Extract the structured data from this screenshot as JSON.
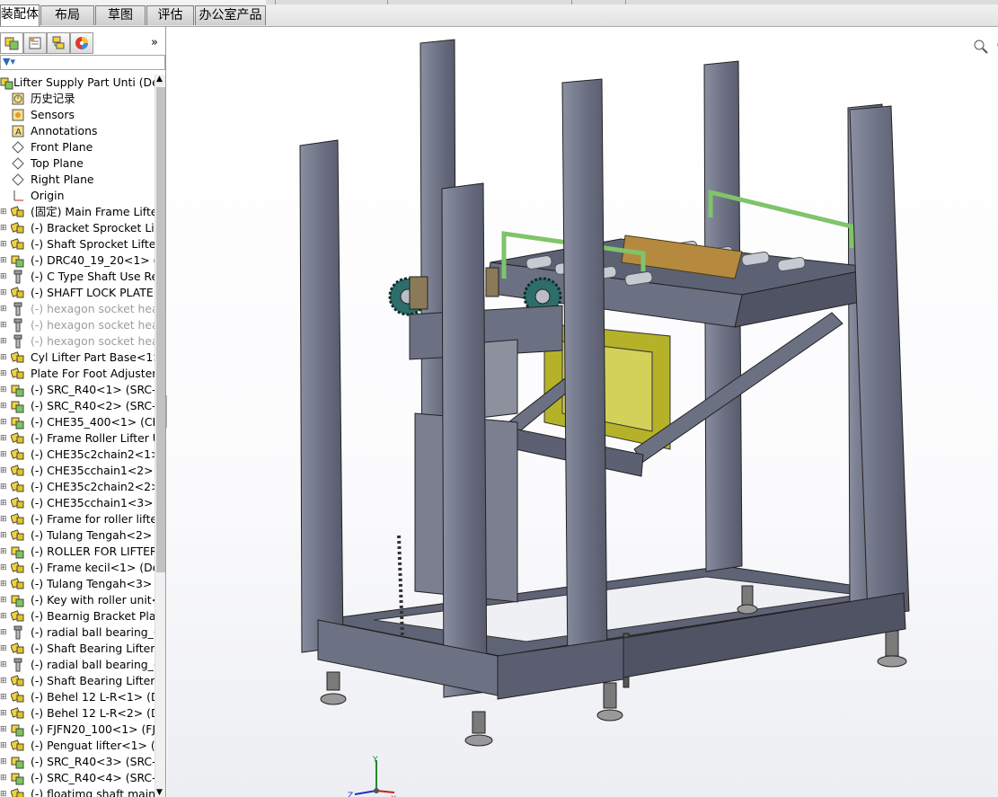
{
  "command_tabs": [
    "装配体",
    "布局",
    "草图",
    "评估",
    "办公室产品"
  ],
  "active_tab": "装配体",
  "tree": {
    "root": "Lifter Supply Part Unti  (De",
    "items": [
      {
        "label": "历史记录",
        "icon": "history-icon",
        "dim": false
      },
      {
        "label": "Sensors",
        "icon": "sensor-icon",
        "dim": false
      },
      {
        "label": "Annotations",
        "icon": "annotation-icon",
        "dim": false
      },
      {
        "label": "Front Plane",
        "icon": "plane-icon",
        "dim": false
      },
      {
        "label": "Top Plane",
        "icon": "plane-icon",
        "dim": false
      },
      {
        "label": "Right Plane",
        "icon": "plane-icon",
        "dim": false
      },
      {
        "label": "Origin",
        "icon": "origin-icon",
        "dim": false
      },
      {
        "label": "(固定) Main Frame Lifter",
        "icon": "subassembly-icon",
        "dim": false
      },
      {
        "label": "(-) Bracket Sprocket Lif",
        "icon": "subassembly-icon",
        "dim": false
      },
      {
        "label": "(-) Shaft Sprocket Lifter",
        "icon": "subassembly-icon",
        "dim": false
      },
      {
        "label": "(-) DRC40_19_20<1> (D",
        "icon": "part-icon",
        "dim": false
      },
      {
        "label": "(-) C Type Shaft Use Re",
        "icon": "screw-icon",
        "dim": false
      },
      {
        "label": "(-) SHAFT LOCK PLATE I",
        "icon": "subassembly-icon",
        "dim": false
      },
      {
        "label": "(-) hexagon socket hea",
        "icon": "screw-icon",
        "dim": true
      },
      {
        "label": "(-) hexagon socket hea",
        "icon": "screw-icon",
        "dim": true
      },
      {
        "label": "(-) hexagon socket hea",
        "icon": "screw-icon",
        "dim": true
      },
      {
        "label": "Cyl Lifter Part Base<1>",
        "icon": "subassembly-icon",
        "dim": false
      },
      {
        "label": "Plate For Foot Adjuster",
        "icon": "subassembly-icon",
        "dim": false
      },
      {
        "label": "(-) SRC_R40<1> (SRC-R",
        "icon": "part-icon",
        "dim": false
      },
      {
        "label": "(-) SRC_R40<2> (SRC-R",
        "icon": "part-icon",
        "dim": false
      },
      {
        "label": "(-) CHE35_400<1> (CHE",
        "icon": "part-icon",
        "dim": false
      },
      {
        "label": "(-) Frame Roller Lifter U",
        "icon": "subassembly-icon",
        "dim": false
      },
      {
        "label": "(-) CHE35c2chain2<1>",
        "icon": "subassembly-icon",
        "dim": false
      },
      {
        "label": "(-) CHE35cchain1<2> (D",
        "icon": "subassembly-icon",
        "dim": false
      },
      {
        "label": "(-) CHE35c2chain2<2>",
        "icon": "subassembly-icon",
        "dim": false
      },
      {
        "label": "(-) CHE35cchain1<3> (D",
        "icon": "subassembly-icon",
        "dim": false
      },
      {
        "label": "(-) Frame for roller lifte",
        "icon": "subassembly-icon",
        "dim": false
      },
      {
        "label": "(-) Tulang Tengah<2> (",
        "icon": "subassembly-icon",
        "dim": false
      },
      {
        "label": "(-) ROLLER FOR LIFTER",
        "icon": "part-icon",
        "dim": false
      },
      {
        "label": "(-) Frame kecil<1> (Def",
        "icon": "subassembly-icon",
        "dim": false
      },
      {
        "label": "(-) Tulang Tengah<3> (",
        "icon": "subassembly-icon",
        "dim": false
      },
      {
        "label": "(-) Key with roller unit<",
        "icon": "part-icon",
        "dim": false
      },
      {
        "label": "(-) Bearnig Bracket Plat",
        "icon": "subassembly-icon",
        "dim": false
      },
      {
        "label": "(-) radial ball bearing_6",
        "icon": "screw-icon",
        "dim": false
      },
      {
        "label": "(-) Shaft Bearing Lifter F",
        "icon": "subassembly-icon",
        "dim": false
      },
      {
        "label": "(-) radial ball bearing_6",
        "icon": "screw-icon",
        "dim": false
      },
      {
        "label": "(-) Shaft Bearing Lifter F",
        "icon": "subassembly-icon",
        "dim": false
      },
      {
        "label": "(-) Behel 12  L-R<1> (D",
        "icon": "subassembly-icon",
        "dim": false
      },
      {
        "label": "(-) Behel 12  L-R<2> (D",
        "icon": "subassembly-icon",
        "dim": false
      },
      {
        "label": "(-) FJFN20_100<1> (FJF",
        "icon": "part-icon",
        "dim": false
      },
      {
        "label": "(-) Penguat lifter<1> (D",
        "icon": "subassembly-icon",
        "dim": false
      },
      {
        "label": "(-) SRC_R40<3> (SRC-R",
        "icon": "part-icon",
        "dim": false
      },
      {
        "label": "(-) SRC_R40<4> (SRC-R",
        "icon": "part-icon",
        "dim": false
      },
      {
        "label": "(-) floatimg shaft main",
        "icon": "subassembly-icon",
        "dim": false
      }
    ]
  },
  "triad": {
    "x": "X",
    "y": "Y",
    "z": "Z"
  },
  "heads_up_icons": [
    "zoom-to-fit-icon",
    "zoom-area-icon",
    "previous-view-icon",
    "section-view-icon",
    "view-orientation-icon",
    "display-style-icon",
    "hide-show-icon",
    "appearance-icon"
  ],
  "colors": {
    "frame": "#6b6f82",
    "bracket": "#b5b229",
    "handle": "#7fc46a",
    "roller": "#c6cbd3",
    "sprocket": "#2e6e6a"
  }
}
